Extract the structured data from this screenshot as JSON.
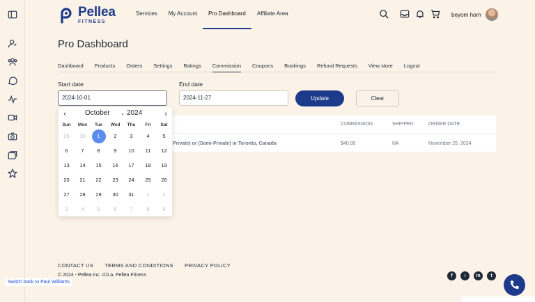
{
  "brand": {
    "name": "Pellea",
    "sub": "FITNESS"
  },
  "nav": [
    "Services",
    "My Account",
    "Pro Dashboard",
    "Affiliate Area"
  ],
  "user": {
    "name": "beyorn horn"
  },
  "page": {
    "title": "Pro Dashboard"
  },
  "subnav": [
    "Dashboard",
    "Products",
    "Orders",
    "Settings",
    "Ratings",
    "Commission",
    "Coupons",
    "Bookings",
    "Refund Requests",
    "View store",
    "Logout"
  ],
  "filters": {
    "start_label": "Start date",
    "start_value": "2024-10-01",
    "end_label": "End date",
    "end_value": "2024-11-27",
    "update_label": "Update",
    "clear_label": "Clear"
  },
  "table": {
    "headers": {
      "commission": "COMMISSION",
      "shipped": "SHIPPED",
      "order_date": "ORDER DATE"
    },
    "row": {
      "product": "Private) or (Semi-Private) in Toronto, Canada",
      "commission": "$40.00",
      "shipped": "NA",
      "order_date": "November 25, 2024"
    }
  },
  "calendar": {
    "month": "October",
    "year": "2024",
    "weekdays": [
      "Sun",
      "Mon",
      "Tue",
      "Wed",
      "Thu",
      "Fri",
      "Sat"
    ],
    "weeks": [
      [
        "29",
        "30",
        "1",
        "2",
        "3",
        "4",
        "5"
      ],
      [
        "6",
        "7",
        "8",
        "9",
        "10",
        "11",
        "12"
      ],
      [
        "13",
        "14",
        "15",
        "16",
        "17",
        "18",
        "19"
      ],
      [
        "20",
        "21",
        "22",
        "23",
        "24",
        "25",
        "26"
      ],
      [
        "27",
        "28",
        "29",
        "30",
        "31",
        "1",
        "2"
      ],
      [
        "3",
        "4",
        "5",
        "6",
        "7",
        "8",
        "9"
      ]
    ],
    "selected": "1"
  },
  "footer": {
    "links": [
      "CONTACT US",
      "TERMS AND CONDITIONS",
      "PRIVACY POLICY"
    ],
    "copyright": "© 2024 - Pellea Inc. d.b.a. Pellea Fitness",
    "socials": [
      "facebook-icon",
      "instagram-icon",
      "linkedin-icon",
      "twitter-icon"
    ]
  },
  "switch_back": "Switch back to Paul Williams",
  "colors": {
    "brand": "#1e3a8a",
    "background": "#fbf3e8",
    "selected_day": "#5b8def"
  }
}
